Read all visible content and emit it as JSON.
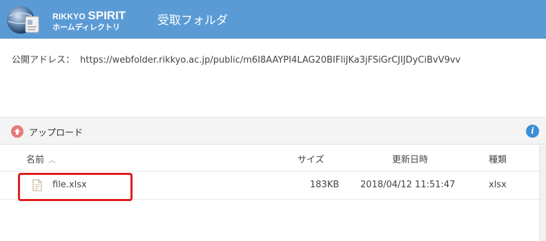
{
  "header": {
    "brand_line1_small": "RIKKYO ",
    "brand_line1_big": "SPIRIT",
    "brand_line2": "ホームディレクトリ",
    "title": "受取フォルダ",
    "bar_color": "#5b9bd5"
  },
  "address": {
    "label": "公開アドレス：",
    "url": "https://webfolder.rikkyo.ac.jp/public/m6I8AAYPI4LAG20BIFliJKa3jFSiGrCJIJDyCiBvV9vv"
  },
  "toolbar": {
    "upload_icon": "upload-arrow-icon",
    "upload_label": "アップロード",
    "info_icon": "info-icon",
    "info_glyph": "i"
  },
  "table": {
    "columns": {
      "name": "名前",
      "size": "サイズ",
      "date": "更新日時",
      "type": "種類"
    },
    "sort_icon": "chevron-up-icon",
    "rows": [
      {
        "icon": "file-icon",
        "name": "file.xlsx",
        "size": "183KB",
        "date": "2018/04/12 11:51:47",
        "type": "xlsx"
      }
    ]
  },
  "highlight_color": "#e01b1b"
}
